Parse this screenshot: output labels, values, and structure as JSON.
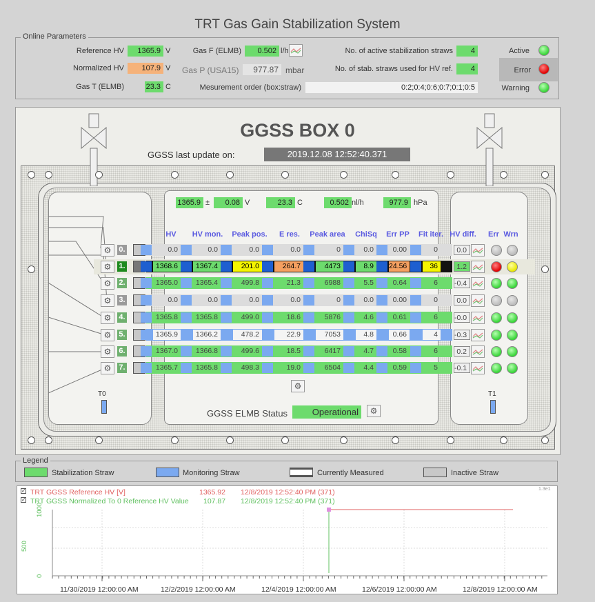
{
  "title": "TRT Gas Gain Stabilization System",
  "online": {
    "label": "Online Parameters",
    "reference_hv": {
      "label": "Reference HV",
      "value": "1365.9",
      "unit": "V"
    },
    "normalized_hv": {
      "label": "Normalized HV",
      "value": "107.9",
      "unit": "V"
    },
    "gas_t": {
      "label": "Gas T (ELMB)",
      "value": "23.3",
      "unit": "C"
    },
    "gas_f": {
      "label": "Gas F (ELMB)",
      "value": "0.502",
      "unit": "l/h"
    },
    "gas_p": {
      "label": "Gas P (USA15)",
      "value": "977.87",
      "unit": "mbar"
    },
    "order": {
      "label": "Mesurement order (box:straw)",
      "value": "0:2;0:4;0:6;0:7;0:1;0:5"
    },
    "active_straws": {
      "label": "No. of active stabilization straws",
      "value": "4"
    },
    "hv_ref_straws": {
      "label": "No. of stab. straws used for HV ref.",
      "value": "4"
    },
    "status": {
      "active": "Active",
      "error": "Error",
      "warning": "Warning"
    }
  },
  "box": {
    "title": "GGSS BOX 0",
    "update_label": "GGSS last update on:",
    "update_value": "2019.12.08 12:52:40.371",
    "summary": {
      "hv": "1365.9",
      "pm": "±",
      "hv_err": "0.08",
      "hv_unit": "V",
      "t": "23.3",
      "t_unit": "C",
      "f": "0.502",
      "f_unit": "nl/h",
      "p": "977.9",
      "p_unit": "hPa"
    },
    "headers": [
      "HV",
      "HV mon.",
      "Peak pos.",
      "E res.",
      "Peak area",
      "ChiSq",
      "Err PP",
      "Fit iter.",
      "HV diff.",
      "Err",
      "Wrn"
    ],
    "rows": [
      {
        "num": "0.",
        "hv": "0.0",
        "hvmon": "0.0",
        "peak": "0.0",
        "eres": "0.0",
        "area": "0",
        "chisq": "0.0",
        "errpp": "0.00",
        "fit": "0",
        "diff": "0.0"
      },
      {
        "num": "1.",
        "hv": "1368.6",
        "hvmon": "1367.4",
        "peak": "201.0",
        "eres": "264.7",
        "area": "4473",
        "chisq": "8.9",
        "errpp": "24.56",
        "fit": "36",
        "diff": "1.2"
      },
      {
        "num": "2.",
        "hv": "1365.0",
        "hvmon": "1365.4",
        "peak": "499.8",
        "eres": "21.3",
        "area": "6988",
        "chisq": "5.5",
        "errpp": "0.64",
        "fit": "6",
        "diff": "-0.4"
      },
      {
        "num": "3.",
        "hv": "0.0",
        "hvmon": "0.0",
        "peak": "0.0",
        "eres": "0.0",
        "area": "0",
        "chisq": "0.0",
        "errpp": "0.00",
        "fit": "0",
        "diff": "0.0"
      },
      {
        "num": "4.",
        "hv": "1365.8",
        "hvmon": "1365.8",
        "peak": "499.0",
        "eres": "18.6",
        "area": "5876",
        "chisq": "4.6",
        "errpp": "0.61",
        "fit": "6",
        "diff": "-0.0"
      },
      {
        "num": "5.",
        "hv": "1365.9",
        "hvmon": "1366.2",
        "peak": "478.2",
        "eres": "22.9",
        "area": "7053",
        "chisq": "4.8",
        "errpp": "0.66",
        "fit": "4",
        "diff": "-0.3"
      },
      {
        "num": "6.",
        "hv": "1367.0",
        "hvmon": "1366.8",
        "peak": "499.6",
        "eres": "18.5",
        "area": "6417",
        "chisq": "4.7",
        "errpp": "0.58",
        "fit": "6",
        "diff": "0.2"
      },
      {
        "num": "7.",
        "hv": "1365.7",
        "hvmon": "1365.8",
        "peak": "498.3",
        "eres": "19.0",
        "area": "6504",
        "chisq": "4.4",
        "errpp": "0.59",
        "fit": "5",
        "diff": "-0.1"
      }
    ],
    "t0": "T0",
    "t1": "T1",
    "elmb_label": "GGSS ELMB Status",
    "elmb_value": "Operational"
  },
  "legend": {
    "label": "Legend",
    "items": [
      "Stabilization Straw",
      "Monitoring Straw",
      "Currently Measured",
      "Inactive Straw"
    ]
  },
  "trend": {
    "s1": {
      "name": "TRT GGSS Reference HV [V]",
      "value": "1365.92",
      "time": "12/8/2019 12:52:40 PM (371)"
    },
    "s2": {
      "name": "TRT GGSS Normalized To 0 Reference HV Value",
      "value": "107.87",
      "time": "12/8/2019 12:52:40 PM (371)"
    },
    "y_ticks": [
      "1000",
      "500",
      "0"
    ],
    "x_ticks": [
      "11/30/2019 12:00:00 AM",
      "12/2/2019 12:00:00 AM",
      "12/4/2019 12:00:00 AM",
      "12/6/2019 12:00:00 AM",
      "12/8/2019 12:00:00 AM"
    ],
    "corner": "1.3e1"
  },
  "colors": {
    "stab": "#6ddb6d",
    "mon": "#7ba9f0",
    "err": "#f5a060",
    "yellow": "#f5f500"
  }
}
